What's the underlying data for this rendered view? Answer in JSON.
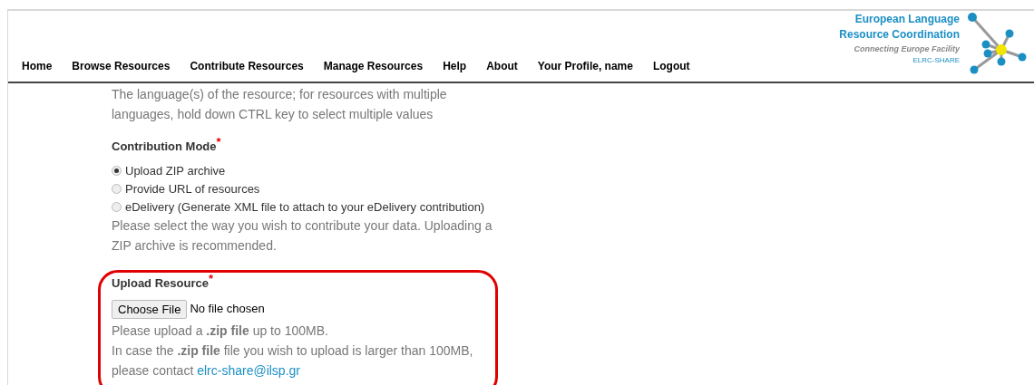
{
  "nav": [
    {
      "label": "Home"
    },
    {
      "label": "Browse Resources"
    },
    {
      "label": "Contribute Resources"
    },
    {
      "label": "Manage Resources"
    },
    {
      "label": "Help"
    },
    {
      "label": "About"
    },
    {
      "label": "Your Profile, name"
    },
    {
      "label": "Logout"
    }
  ],
  "logo": {
    "title_lines": [
      "European Language",
      "Resource Coordination"
    ],
    "tagline": "Connecting Europe Facility",
    "product": "ELRC-SHARE"
  },
  "language_help": "The language(s) of the resource; for resources with multiple languages, hold down CTRL key to select multiple values",
  "contribution_mode": {
    "label": "Contribution Mode",
    "required_mark": "*",
    "options": [
      {
        "label": "Upload ZIP archive",
        "selected": true
      },
      {
        "label": "Provide URL of resources",
        "selected": false
      },
      {
        "label": "eDelivery (Generate XML file to attach to your eDelivery contribution)",
        "selected": false
      }
    ],
    "help": "Please select the way you wish to contribute your data. Uploading a ZIP archive is recommended."
  },
  "upload_resource": {
    "label": "Upload Resource",
    "required_mark": "*",
    "button": "Choose File",
    "file_status": "No file chosen",
    "help": "Please upload a **.zip file** up to 100MB.",
    "help_2": "In case the **.zip file** file you wish to upload is larger than 100MB, please contact",
    "contact_link": "elrc-share@ilsp.gr",
    "highlighted": true
  }
}
